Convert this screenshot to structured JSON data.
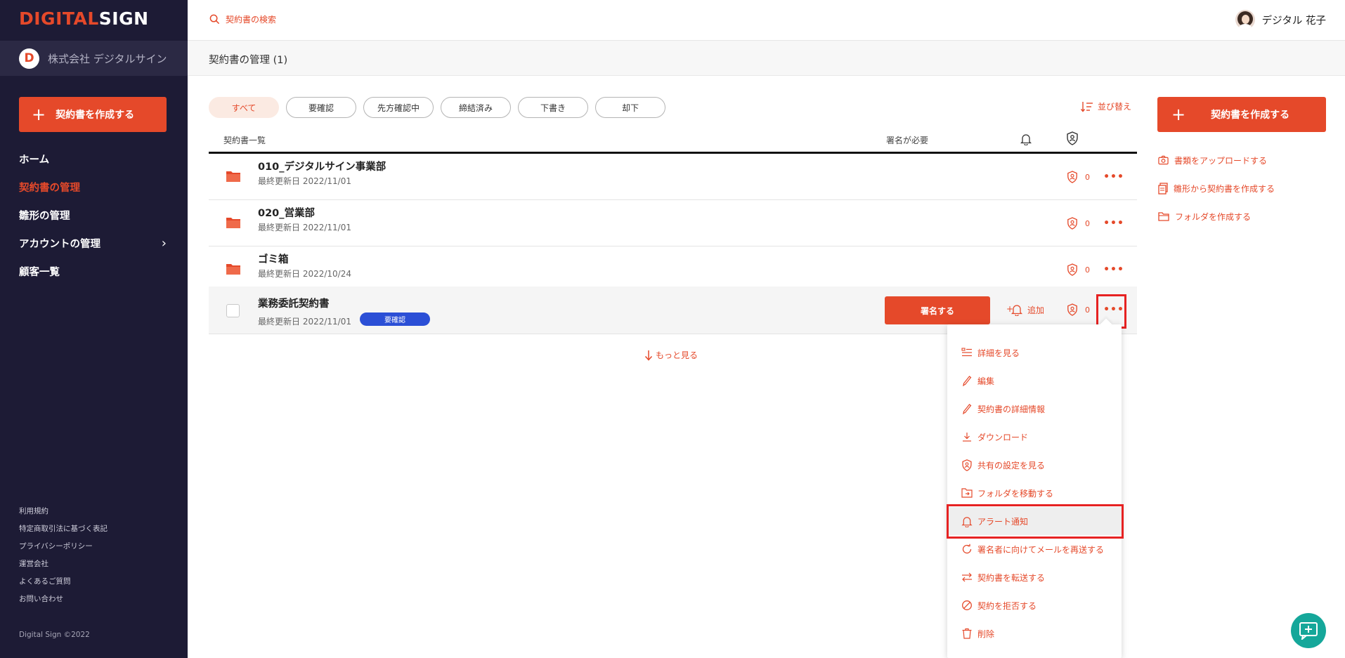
{
  "app": {
    "logo_part1": "DIGITAL",
    "logo_part2": "SIGN",
    "company_initial": "D",
    "company_name": "株式会社 デジタルサイン",
    "create_button": "契約書を作成する"
  },
  "sidebar": {
    "items": [
      {
        "label": "ホーム"
      },
      {
        "label": "契約書の管理"
      },
      {
        "label": "雛形の管理"
      },
      {
        "label": "アカウントの管理"
      },
      {
        "label": "顧客一覧"
      }
    ],
    "footer_links": [
      "利用規約",
      "特定商取引法に基づく表記",
      "プライバシーポリシー",
      "運営会社",
      "よくあるご質問",
      "お問い合わせ"
    ],
    "copyright": "Digital Sign ©2022"
  },
  "header": {
    "search_placeholder": "契約書の検索",
    "user_name": "デジタル 花子"
  },
  "page": {
    "title": "契約書の管理 (1)"
  },
  "filters": [
    "すべて",
    "要確認",
    "先方確認中",
    "締結済み",
    "下書き",
    "却下"
  ],
  "sort_label": "並び替え",
  "table": {
    "col_list": "契約書一覧",
    "col_sign": "署名が必要",
    "rows": [
      {
        "name": "010_デジタルサイン事業部",
        "date": "最終更新日 2022/11/01",
        "share_count": "0"
      },
      {
        "name": "020_営業部",
        "date": "最終更新日 2022/11/01",
        "share_count": "0"
      },
      {
        "name": "ゴミ箱",
        "date": "最終更新日 2022/10/24",
        "share_count": "0"
      },
      {
        "name": "業務委託契約書",
        "date": "最終更新日 2022/11/01",
        "share_count": "0",
        "status": "要確認",
        "sign_button": "署名する",
        "add_alert": "追加"
      }
    ],
    "more_label": "もっと見る"
  },
  "right_actions": [
    "書類をアップロードする",
    "雛形から契約書を作成する",
    "フォルダを作成する"
  ],
  "dropdown": {
    "items": [
      "詳細を見る",
      "編集",
      "契約書の詳細情報",
      "ダウンロード",
      "共有の設定を見る",
      "フォルダを移動する",
      "アラート通知",
      "署名者に向けてメールを再送する",
      "契約書を転送する",
      "契約を拒否する",
      "削除"
    ]
  },
  "colors": {
    "accent": "#e5492a",
    "sidebar_bg": "#1d1b35",
    "status_blue": "#2b4fd6",
    "fab_teal": "#15a79a",
    "highlight_red": "#e62222"
  }
}
